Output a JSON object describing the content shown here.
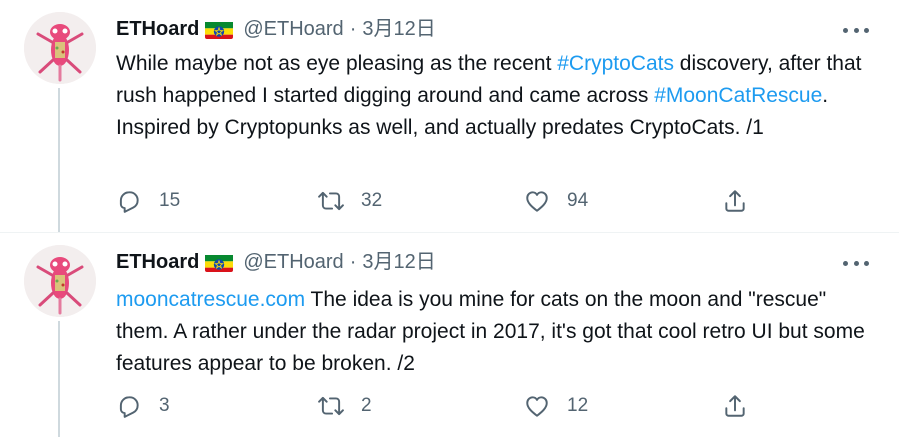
{
  "tweets": [
    {
      "author": "ETHoard",
      "handle": "@ETHoard",
      "separator": "·",
      "date": "3月12日",
      "flag_icon": "ethiopia-flag-icon",
      "body_segments": [
        {
          "text": "While maybe not as eye pleasing as the recent ",
          "type": "text"
        },
        {
          "text": "#CryptoCats",
          "type": "link"
        },
        {
          "text": " discovery, after that rush happened I started digging around and came across ",
          "type": "text"
        },
        {
          "text": "#MoonCatRescue",
          "type": "link"
        },
        {
          "text": ". Inspired by Cryptopunks as well, and actually predates CryptoCats. /1",
          "type": "text"
        }
      ],
      "replies": "15",
      "retweets": "32",
      "likes": "94"
    },
    {
      "author": "ETHoard",
      "handle": "@ETHoard",
      "separator": "·",
      "date": "3月12日",
      "flag_icon": "ethiopia-flag-icon",
      "body_segments": [
        {
          "text": "mooncatrescue.com",
          "type": "link"
        },
        {
          "text": " The idea is you mine for cats on the moon and \"rescue\" them. A rather under the radar project in 2017, it's got that cool retro UI but some features appear to be broken. /2",
          "type": "text"
        }
      ],
      "replies": "3",
      "retweets": "2",
      "likes": "12"
    }
  ],
  "colors": {
    "text_primary": "#0f1419",
    "text_secondary": "#536471",
    "link": "#1d9bf0",
    "thread_line": "#cfd9de"
  }
}
